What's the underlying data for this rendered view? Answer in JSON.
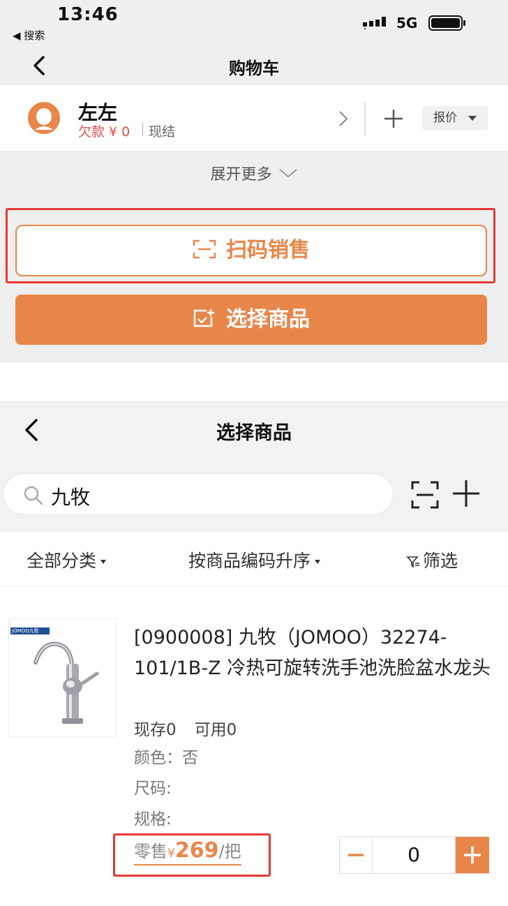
{
  "status_bar": {
    "time": "13:46",
    "back_label": "◀ 搜索",
    "network": "5G"
  },
  "cart_header": {
    "title": "购物车"
  },
  "customer": {
    "name": "左左",
    "debt": "欠款 ¥ 0",
    "settlement": "现结",
    "quote_label": "报价"
  },
  "expand_label": "展开更多",
  "scan_sale_label": "扫码销售",
  "select_goods_label": "选择商品",
  "select_header": {
    "title": "选择商品"
  },
  "search": {
    "value": "九牧"
  },
  "filters": {
    "category": "全部分类",
    "sort": "按商品编码升序",
    "filter": "筛选"
  },
  "product": {
    "brand_tag": "JOMOO九牧",
    "title": "[0900008] 九牧（JOMOO）32274-101/1B-Z 冷热可旋转洗手池洗脸盆水龙头",
    "stock": "现存0",
    "available": "可用0",
    "color": "颜色：否",
    "size": "尺码:",
    "spec": "规格:",
    "price_prefix": "零售",
    "currency": "¥",
    "price": "269",
    "unit": "/把",
    "quantity": "0"
  },
  "colors": {
    "accent": "#e8864a",
    "highlight": "#e53935",
    "debt": "#d9534f"
  }
}
